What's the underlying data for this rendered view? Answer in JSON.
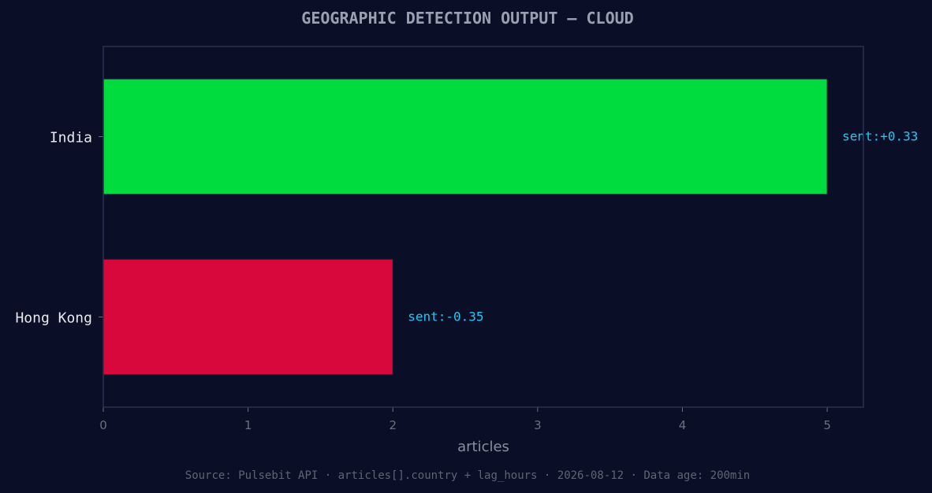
{
  "title": "GEOGRAPHIC DETECTION OUTPUT — CLOUD",
  "source": "Source: Pulsebit API · articles[].country + lag_hours · 2026-08-12 · Data age: 200min",
  "colors": {
    "background": "#0a0f27",
    "frame": "#2a3050",
    "positive_bar": "#00db3e",
    "negative_bar": "#d8083c",
    "annotation": "#20c8f0"
  },
  "chart_data": {
    "type": "bar",
    "orientation": "horizontal",
    "categories": [
      "India",
      "Hong Kong"
    ],
    "values": [
      5,
      2
    ],
    "annotations": [
      "sent:+0.33",
      "sent:-0.35"
    ],
    "bar_colors": [
      "#00db3e",
      "#d8083c"
    ],
    "xlabel": "articles",
    "ylabel": "",
    "xlim": [
      0,
      5.25
    ],
    "xticks": [
      0,
      1,
      2,
      3,
      4,
      5
    ],
    "grid": false
  }
}
